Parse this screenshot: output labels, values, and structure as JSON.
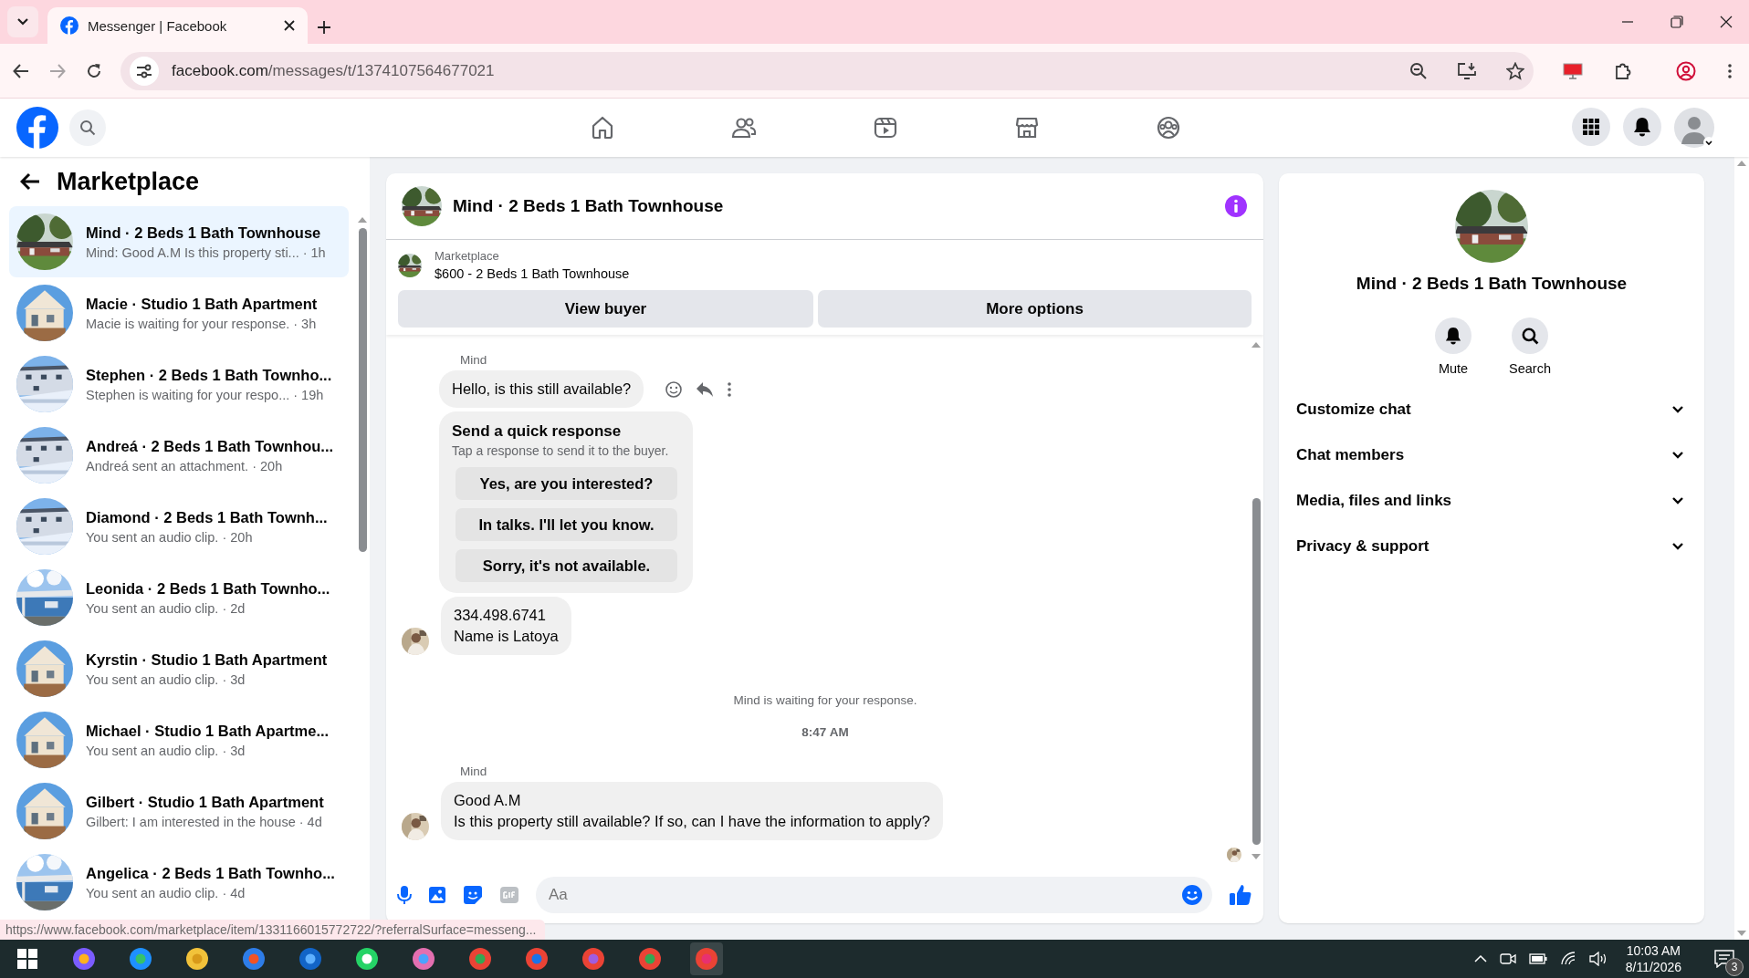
{
  "browser": {
    "tabs": [
      {
        "title": "Messenger | Facebook",
        "selected": true
      }
    ],
    "url_host": "facebook.com",
    "url_path": "/messages/t/1374107564677021",
    "status_url": "https://www.facebook.com/marketplace/item/1331166015772722/?referralSurface=messeng..."
  },
  "sidebar": {
    "title": "Marketplace",
    "conversations": [
      {
        "title": "Mind · 2 Beds 1 Bath Townhouse",
        "preview": "Mind: Good A.M Is this property sti...",
        "time": "· 1h",
        "selected": true
      },
      {
        "title": "Macie · Studio 1 Bath Apartment",
        "preview": "Macie is waiting for your response.",
        "time": "· 3h",
        "selected": false
      },
      {
        "title": "Stephen · 2 Beds 1 Bath Townho...",
        "preview": "Stephen is waiting for your respo...",
        "time": "· 19h",
        "selected": false
      },
      {
        "title": "Andreá · 2 Beds 1 Bath Townhou...",
        "preview": "Andreá sent an attachment.",
        "time": "· 20h",
        "selected": false
      },
      {
        "title": "Diamond · 2 Beds 1 Bath Townh...",
        "preview": "You sent an audio clip.",
        "time": "· 20h",
        "selected": false
      },
      {
        "title": "Leonida · 2 Beds 1 Bath Townho...",
        "preview": "You sent an audio clip.",
        "time": "· 2d",
        "selected": false
      },
      {
        "title": "Kyrstin · Studio 1 Bath Apartment",
        "preview": "You sent an audio clip.",
        "time": "· 3d",
        "selected": false
      },
      {
        "title": "Michael · Studio 1 Bath Apartme...",
        "preview": "You sent an audio clip.",
        "time": "· 3d",
        "selected": false
      },
      {
        "title": "Gilbert · Studio 1 Bath Apartment",
        "preview": "Gilbert: I am interested in the house",
        "time": "· 4d",
        "selected": false
      },
      {
        "title": "Angelica · 2 Beds 1 Bath Townho...",
        "preview": "You sent an audio clip.",
        "time": "· 4d",
        "selected": false
      }
    ]
  },
  "chat": {
    "title": "Mind · 2 Beds 1 Bath Townhouse",
    "listing": {
      "label": "Marketplace",
      "title": "$600 - 2 Beds 1 Bath Townhouse"
    },
    "actions": [
      "View buyer",
      "More options"
    ],
    "messages": [
      {
        "kind": "sender",
        "text": "Mind"
      },
      {
        "kind": "text",
        "lines": [
          "Hello, is this still available?"
        ],
        "avatar": false,
        "hovered": true
      },
      {
        "kind": "quick_response",
        "title": "Send a quick response",
        "subtitle": "Tap a response to send it to the buyer.",
        "options": [
          "Yes, are you interested?",
          "In talks. I'll let you know.",
          "Sorry, it's not available."
        ]
      },
      {
        "kind": "text",
        "lines": [
          "334.498.6741",
          "Name is Latoya"
        ],
        "avatar": true,
        "hovered": false
      },
      {
        "kind": "status",
        "text": "Mind is waiting for your response."
      },
      {
        "kind": "time",
        "text": "8:47 AM"
      },
      {
        "kind": "sender",
        "text": "Mind"
      },
      {
        "kind": "text",
        "lines": [
          "Good A.M",
          "Is this property still available? If so, can I have the information to apply?"
        ],
        "avatar": true,
        "hovered": false
      },
      {
        "kind": "seen"
      }
    ],
    "composer": {
      "placeholder": "Aa"
    }
  },
  "details": {
    "title": "Mind · 2 Beds 1 Bath Townhouse",
    "actions": [
      {
        "kind": "mute",
        "label": "Mute"
      },
      {
        "kind": "search",
        "label": "Search"
      }
    ],
    "sections": [
      {
        "label": "Customize chat",
        "expanded": false
      },
      {
        "label": "Chat members",
        "expanded": false
      },
      {
        "label": "Media, files and links",
        "expanded": false
      },
      {
        "label": "Privacy & support",
        "expanded": false
      }
    ]
  },
  "taskbar": {
    "time": "10:03 AM",
    "date": "8/11/2026",
    "notifications": "3"
  }
}
